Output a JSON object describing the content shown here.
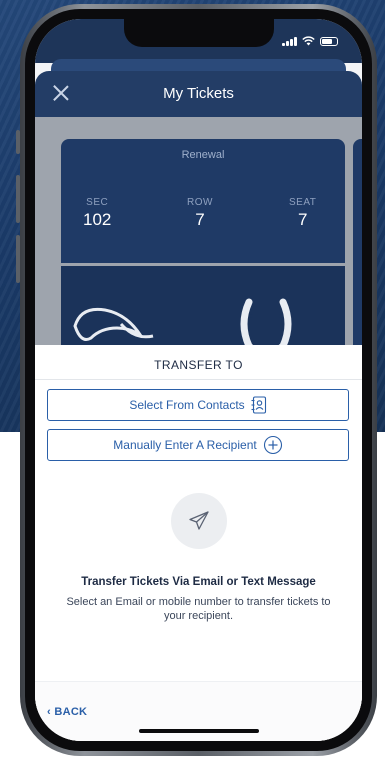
{
  "header": {
    "title": "My Tickets",
    "close_icon": "close-icon"
  },
  "ticket": {
    "tag": "Renewal",
    "sec_label": "SEC",
    "sec_value": "102",
    "row_label": "ROW",
    "row_value": "7",
    "seat_label": "SEAT",
    "seat_value": "7"
  },
  "sheet": {
    "title": "TRANSFER TO",
    "contacts_label": "Select From Contacts",
    "contacts_icon": "contacts-book-icon",
    "manual_label": "Manually Enter A Recipient",
    "manual_icon": "plus-circle-icon",
    "plane_icon": "paper-plane-icon",
    "info_title": "Transfer Tickets Via Email or Text Message",
    "info_body": "Select an Email or mobile number to transfer tickets to your recipient.",
    "back_label": "BACK"
  },
  "colors": {
    "accent": "#2a5fa8",
    "header_bg": "#233d66",
    "ticket_bg": "#1f3a66"
  }
}
